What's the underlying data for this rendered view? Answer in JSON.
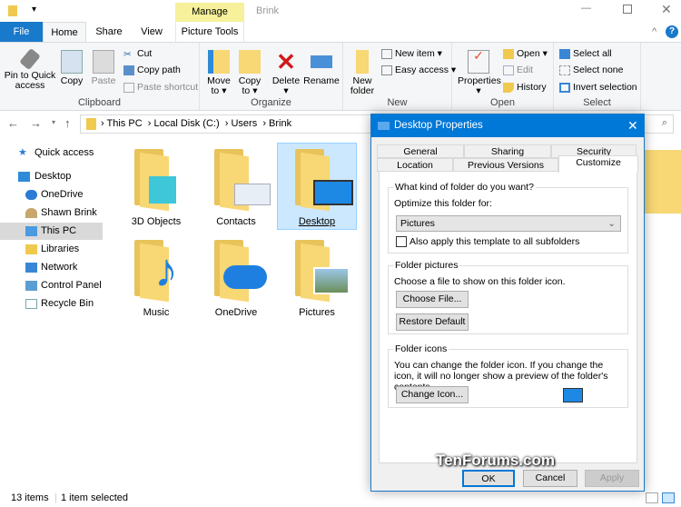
{
  "window": {
    "title": "Brink",
    "manage_label": "Manage",
    "picture_tools_label": "Picture Tools"
  },
  "tabs": [
    "File",
    "Home",
    "Share",
    "View"
  ],
  "ribbon": {
    "clipboard": {
      "label": "Clipboard",
      "pin": "Pin to Quick access",
      "copy": "Copy",
      "paste": "Paste",
      "cut": "Cut",
      "copy_path": "Copy path",
      "paste_shortcut": "Paste shortcut"
    },
    "organize": {
      "label": "Organize",
      "move_to": "Move to",
      "copy_to": "Copy to",
      "delete": "Delete",
      "rename": "Rename"
    },
    "new": {
      "label": "New",
      "new_folder": "New folder",
      "new_item": "New item",
      "easy_access": "Easy access"
    },
    "open": {
      "label": "Open",
      "properties": "Properties",
      "open": "Open",
      "edit": "Edit",
      "history": "History"
    },
    "select": {
      "label": "Select",
      "select_all": "Select all",
      "select_none": "Select none",
      "invert": "Invert selection"
    }
  },
  "address": {
    "crumbs": [
      "This PC",
      "Local Disk (C:)",
      "Users",
      "Brink"
    ]
  },
  "nav": [
    "Quick access",
    "Desktop",
    "OneDrive",
    "Shawn Brink",
    "This PC",
    "Libraries",
    "Network",
    "Control Panel",
    "Recycle Bin"
  ],
  "items": [
    "3D Objects",
    "Contacts",
    "Desktop",
    "Music",
    "OneDrive",
    "Pictures"
  ],
  "status": {
    "count": "13 items",
    "selected": "1 item selected"
  },
  "dialog": {
    "title": "Desktop Properties",
    "tabs_row1": [
      "General",
      "Sharing",
      "Security"
    ],
    "tabs_row2": [
      "Location",
      "Previous Versions",
      "Customize"
    ],
    "kind_label": "What kind of folder do you want?",
    "optimize_label": "Optimize this folder for:",
    "optimize_value": "Pictures",
    "apply_sub": "Also apply this template to all subfolders",
    "pictures_label": "Folder pictures",
    "pictures_desc": "Choose a file to show on this folder icon.",
    "choose_file": "Choose File...",
    "restore": "Restore Default",
    "icons_label": "Folder icons",
    "icons_desc": "You can change the folder icon. If you change the icon, it will no longer show a preview of the folder's contents.",
    "change_icon": "Change Icon...",
    "ok": "OK",
    "cancel": "Cancel",
    "apply": "Apply"
  },
  "watermark": "TenForums.com"
}
